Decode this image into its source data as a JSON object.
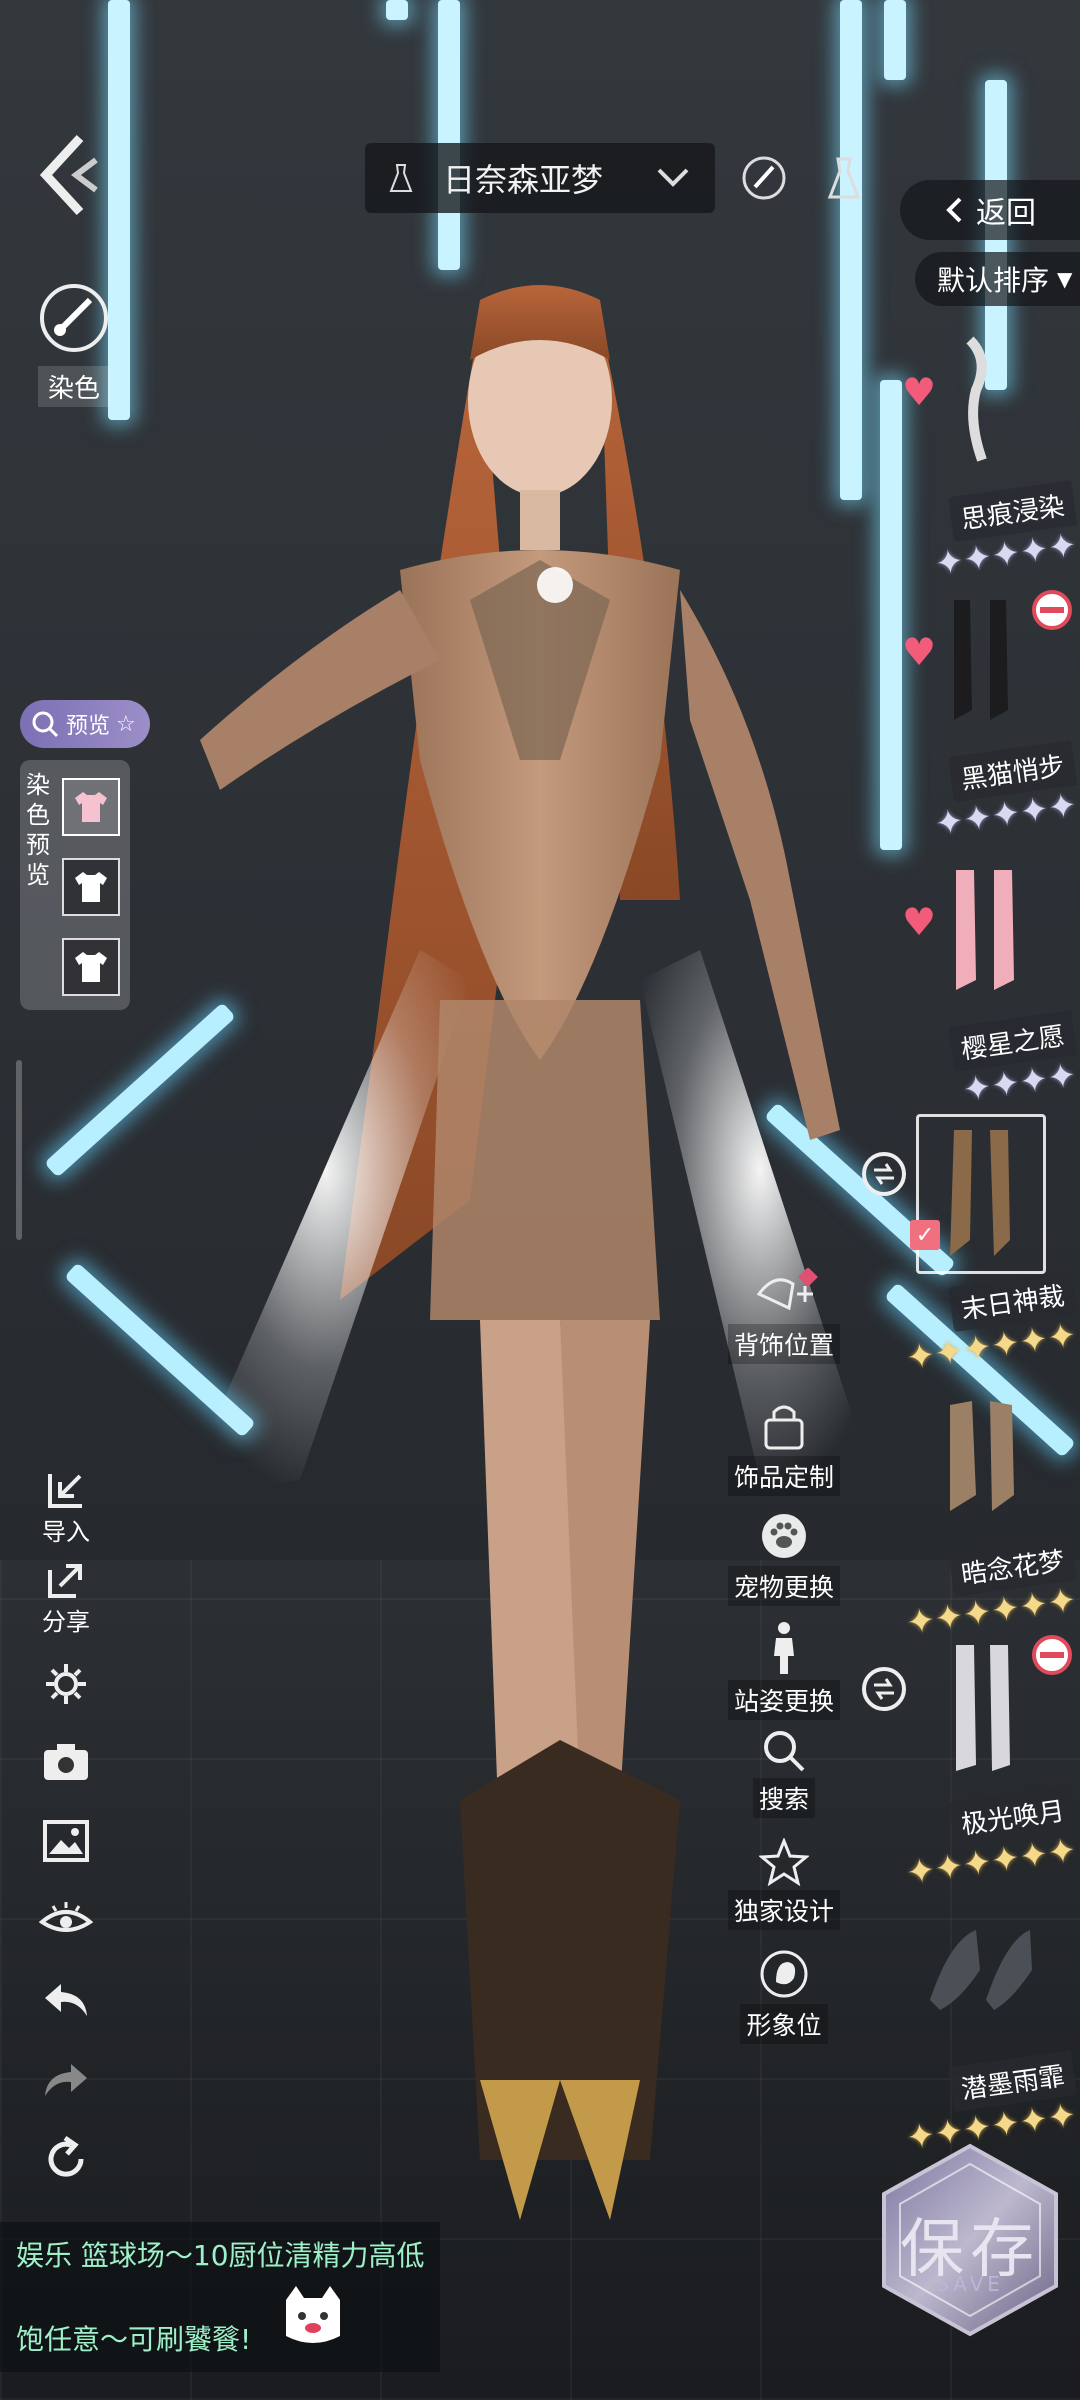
{
  "top_bar": {
    "character_name": "日奈森亚梦",
    "return_label": "返回",
    "sort_label": "默认排序"
  },
  "left_panel": {
    "dye_label": "染色",
    "preview_pill_label": "预览",
    "dye_preview_label": "染色预览"
  },
  "left_toolbar": {
    "import_label": "导入",
    "share_label": "分享"
  },
  "actions": [
    {
      "label": "背饰位置",
      "icon": "back-accessory-icon"
    },
    {
      "label": "饰品定制",
      "icon": "accessory-lock-icon"
    },
    {
      "label": "宠物更换",
      "icon": "paw-icon"
    },
    {
      "label": "站姿更换",
      "icon": "person-stand-icon"
    },
    {
      "label": "搜索",
      "icon": "search-icon"
    },
    {
      "label": "独家设计",
      "icon": "star-icon"
    },
    {
      "label": "形象位",
      "icon": "profile-icon"
    }
  ],
  "items": [
    {
      "name": "思痕浸染",
      "stars": 5,
      "star_color": "silver",
      "liked": true
    },
    {
      "name": "黑猫悄步",
      "stars": 5,
      "star_color": "silver",
      "liked": true,
      "restricted": true
    },
    {
      "name": "樱星之愿",
      "stars": 4,
      "star_color": "silver",
      "liked": true
    },
    {
      "name": "末日神裁",
      "stars": 6,
      "star_color": "gold",
      "selected": true,
      "swap": true
    },
    {
      "name": "晧念花梦",
      "stars": 6,
      "star_color": "gold"
    },
    {
      "name": "极光唤月",
      "stars": 6,
      "star_color": "gold",
      "swap": true,
      "restricted": true
    },
    {
      "name": "潜墨雨霏",
      "stars": 6,
      "star_color": "gold"
    }
  ],
  "chat": {
    "line1": "娱乐 篮球场～10厨位清精力高低",
    "line2": "饱任意～可刷饕餮!"
  },
  "save": {
    "label": "保存",
    "sub": "SAVE"
  }
}
